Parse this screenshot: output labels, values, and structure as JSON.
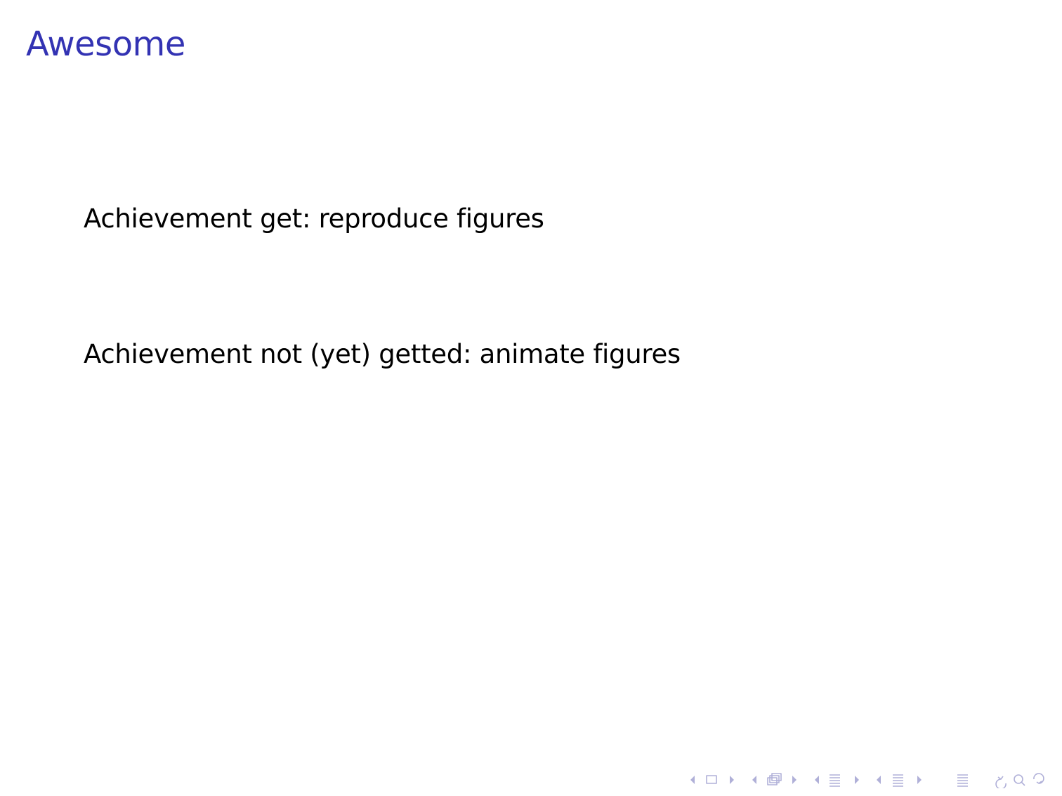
{
  "slide": {
    "title": "Awesome",
    "lines": [
      "Achievement get: reproduce figures",
      "Achievement not (yet) getted: animate figures"
    ]
  },
  "colors": {
    "title": "#3333b3",
    "text": "#000000",
    "nav_symbols": "#b0b0d8"
  },
  "navigation": [
    {
      "name": "frame",
      "icon": "frame-nav-icon"
    },
    {
      "name": "subsection",
      "icon": "subsection-nav-icon"
    },
    {
      "name": "section",
      "icon": "section-nav-icon"
    },
    {
      "name": "document",
      "icon": "document-nav-icon"
    },
    {
      "name": "toc",
      "icon": "toc-icon"
    },
    {
      "name": "search",
      "icon": "search-icon"
    }
  ]
}
